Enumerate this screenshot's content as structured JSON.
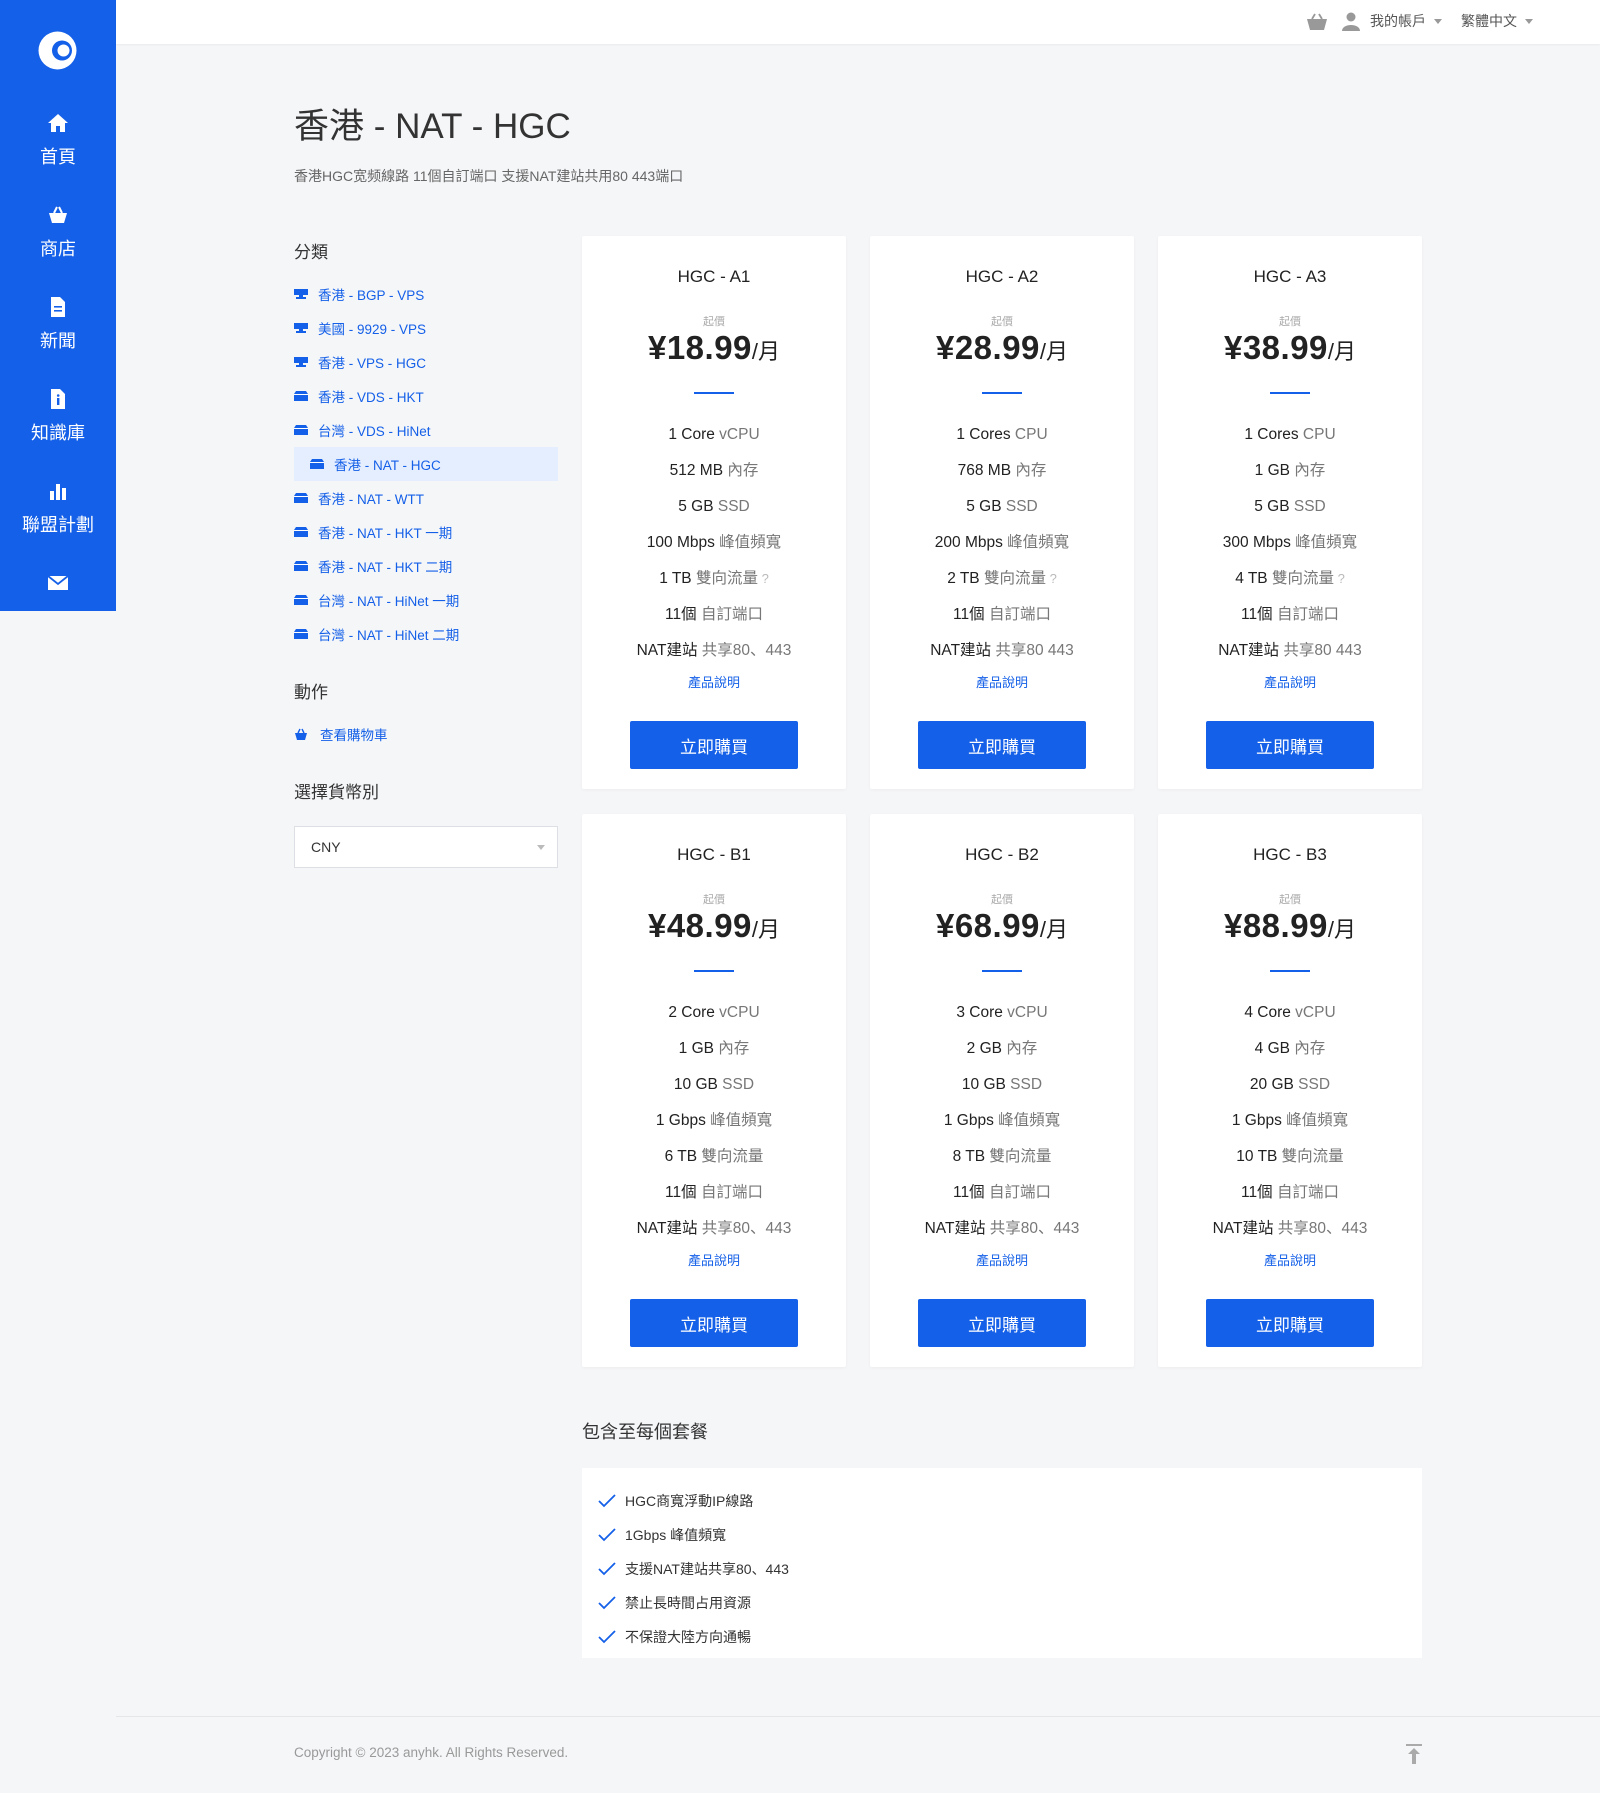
{
  "nav": [
    {
      "label": "首頁",
      "icon": "home-icon"
    },
    {
      "label": "商店",
      "icon": "basket-icon"
    },
    {
      "label": "新聞",
      "icon": "document-icon"
    },
    {
      "label": "知識庫",
      "icon": "info-document-icon"
    },
    {
      "label": "聯盟計劃",
      "icon": "bar-chart-icon"
    },
    {
      "label": "",
      "icon": "mail-icon"
    }
  ],
  "topbar": {
    "account_label": "我的帳戶",
    "language_label": "繁體中文"
  },
  "header": {
    "title": "香港 - NAT - HGC",
    "subtitle": "香港HGC宽频線路 11個自訂端口 支援NAT建站共用80 443端口"
  },
  "sidebar_sections": {
    "categories_title": "分類",
    "actions_title": "動作",
    "currency_title": "選擇貨幣別"
  },
  "categories": [
    {
      "label": "香港 - BGP - VPS",
      "icon": "server-icon",
      "active": false
    },
    {
      "label": "美國 - 9929 - VPS",
      "icon": "server-icon",
      "active": false
    },
    {
      "label": "香港 - VPS - HGC",
      "icon": "server-icon",
      "active": false
    },
    {
      "label": "香港 - VDS - HKT",
      "icon": "box-icon",
      "active": false
    },
    {
      "label": "台灣 - VDS - HiNet",
      "icon": "box-icon",
      "active": false
    },
    {
      "label": "香港 - NAT - HGC",
      "icon": "box-icon",
      "active": true
    },
    {
      "label": "香港 - NAT - WTT",
      "icon": "box-icon",
      "active": false
    },
    {
      "label": "香港 - NAT - HKT 一期",
      "icon": "box-icon",
      "active": false
    },
    {
      "label": "香港 - NAT - HKT 二期",
      "icon": "box-icon",
      "active": false
    },
    {
      "label": "台灣 - NAT - HiNet 一期",
      "icon": "box-icon",
      "active": false
    },
    {
      "label": "台灣 - NAT - HiNet 二期",
      "icon": "box-icon",
      "active": false
    }
  ],
  "actions": {
    "view_cart": "查看購物車"
  },
  "currency": {
    "selected": "CNY"
  },
  "colors": {
    "accent": "#1560e8",
    "active_bg": "#e5eefe",
    "page_bg": "#f5f6f8"
  },
  "products": [
    {
      "name": "HGC - A1",
      "from_label": "起價",
      "price": "¥18.99",
      "period": "/月",
      "features": [
        {
          "value": "1 Core",
          "key": " vCPU",
          "tip": ""
        },
        {
          "value": "512 MB",
          "key": " 內存",
          "tip": ""
        },
        {
          "value": "5 GB",
          "key": " SSD",
          "tip": ""
        },
        {
          "value": "100 Mbps",
          "key": " 峰值頻寬",
          "tip": ""
        },
        {
          "value": "1 TB",
          "key": " 雙向流量",
          "tip": " ?"
        },
        {
          "value": "11個",
          "key": " 自訂端口",
          "tip": ""
        },
        {
          "value": "NAT建站",
          "key": " 共享80、443",
          "tip": ""
        }
      ],
      "desc_link": "產品說明",
      "buy_label": "立即購買"
    },
    {
      "name": "HGC - A2",
      "from_label": "起價",
      "price": "¥28.99",
      "period": "/月",
      "features": [
        {
          "value": "1 Cores",
          "key": " CPU",
          "tip": ""
        },
        {
          "value": "768 MB",
          "key": " 內存",
          "tip": ""
        },
        {
          "value": "5 GB",
          "key": " SSD",
          "tip": ""
        },
        {
          "value": "200 Mbps",
          "key": " 峰值頻寬",
          "tip": ""
        },
        {
          "value": "2 TB",
          "key": " 雙向流量",
          "tip": " ?"
        },
        {
          "value": "11個",
          "key": " 自訂端口",
          "tip": ""
        },
        {
          "value": "NAT建站",
          "key": " 共享80 443",
          "tip": ""
        }
      ],
      "desc_link": "產品說明",
      "buy_label": "立即購買"
    },
    {
      "name": "HGC - A3",
      "from_label": "起價",
      "price": "¥38.99",
      "period": "/月",
      "features": [
        {
          "value": "1 Cores",
          "key": " CPU",
          "tip": ""
        },
        {
          "value": "1 GB",
          "key": " 內存",
          "tip": ""
        },
        {
          "value": "5 GB",
          "key": " SSD",
          "tip": ""
        },
        {
          "value": "300 Mbps",
          "key": " 峰值頻寬",
          "tip": ""
        },
        {
          "value": "4 TB",
          "key": " 雙向流量",
          "tip": " ?"
        },
        {
          "value": "11個",
          "key": " 自訂端口",
          "tip": ""
        },
        {
          "value": "NAT建站",
          "key": " 共享80 443",
          "tip": ""
        }
      ],
      "desc_link": "產品說明",
      "buy_label": "立即購買"
    },
    {
      "name": "HGC - B1",
      "from_label": "起價",
      "price": "¥48.99",
      "period": "/月",
      "features": [
        {
          "value": "2 Core",
          "key": " vCPU",
          "tip": ""
        },
        {
          "value": "1 GB",
          "key": " 內存",
          "tip": ""
        },
        {
          "value": "10 GB",
          "key": " SSD",
          "tip": ""
        },
        {
          "value": "1 Gbps",
          "key": " 峰值頻寬",
          "tip": ""
        },
        {
          "value": "6 TB",
          "key": " 雙向流量",
          "tip": ""
        },
        {
          "value": "11個",
          "key": " 自訂端口",
          "tip": ""
        },
        {
          "value": "NAT建站",
          "key": " 共享80、443",
          "tip": ""
        }
      ],
      "desc_link": "產品說明",
      "buy_label": "立即購買"
    },
    {
      "name": "HGC - B2",
      "from_label": "起價",
      "price": "¥68.99",
      "period": "/月",
      "features": [
        {
          "value": "3 Core",
          "key": " vCPU",
          "tip": ""
        },
        {
          "value": "2 GB",
          "key": " 內存",
          "tip": ""
        },
        {
          "value": "10 GB",
          "key": " SSD",
          "tip": ""
        },
        {
          "value": "1 Gbps",
          "key": " 峰值頻寬",
          "tip": ""
        },
        {
          "value": "8 TB",
          "key": " 雙向流量",
          "tip": ""
        },
        {
          "value": "11個",
          "key": " 自訂端口",
          "tip": ""
        },
        {
          "value": "NAT建站",
          "key": " 共享80、443",
          "tip": ""
        }
      ],
      "desc_link": "產品說明",
      "buy_label": "立即購買"
    },
    {
      "name": "HGC - B3",
      "from_label": "起價",
      "price": "¥88.99",
      "period": "/月",
      "features": [
        {
          "value": "4 Core",
          "key": " vCPU",
          "tip": ""
        },
        {
          "value": "4 GB",
          "key": " 內存",
          "tip": ""
        },
        {
          "value": "20 GB",
          "key": " SSD",
          "tip": ""
        },
        {
          "value": "1 Gbps",
          "key": " 峰值頻寬",
          "tip": ""
        },
        {
          "value": "10 TB",
          "key": " 雙向流量",
          "tip": ""
        },
        {
          "value": "11個",
          "key": " 自訂端口",
          "tip": ""
        },
        {
          "value": "NAT建站",
          "key": " 共享80、443",
          "tip": ""
        }
      ],
      "desc_link": "產品說明",
      "buy_label": "立即購買"
    }
  ],
  "included": {
    "title": "包含至每個套餐",
    "items": [
      "HGC商寬浮動IP線路",
      "1Gbps 峰值頻寬",
      "支援NAT建站共享80、443",
      "禁止長時間占用資源",
      "不保證大陸方向通暢"
    ]
  },
  "footer": {
    "copyright": "Copyright © 2023 anyhk. All Rights Reserved."
  }
}
